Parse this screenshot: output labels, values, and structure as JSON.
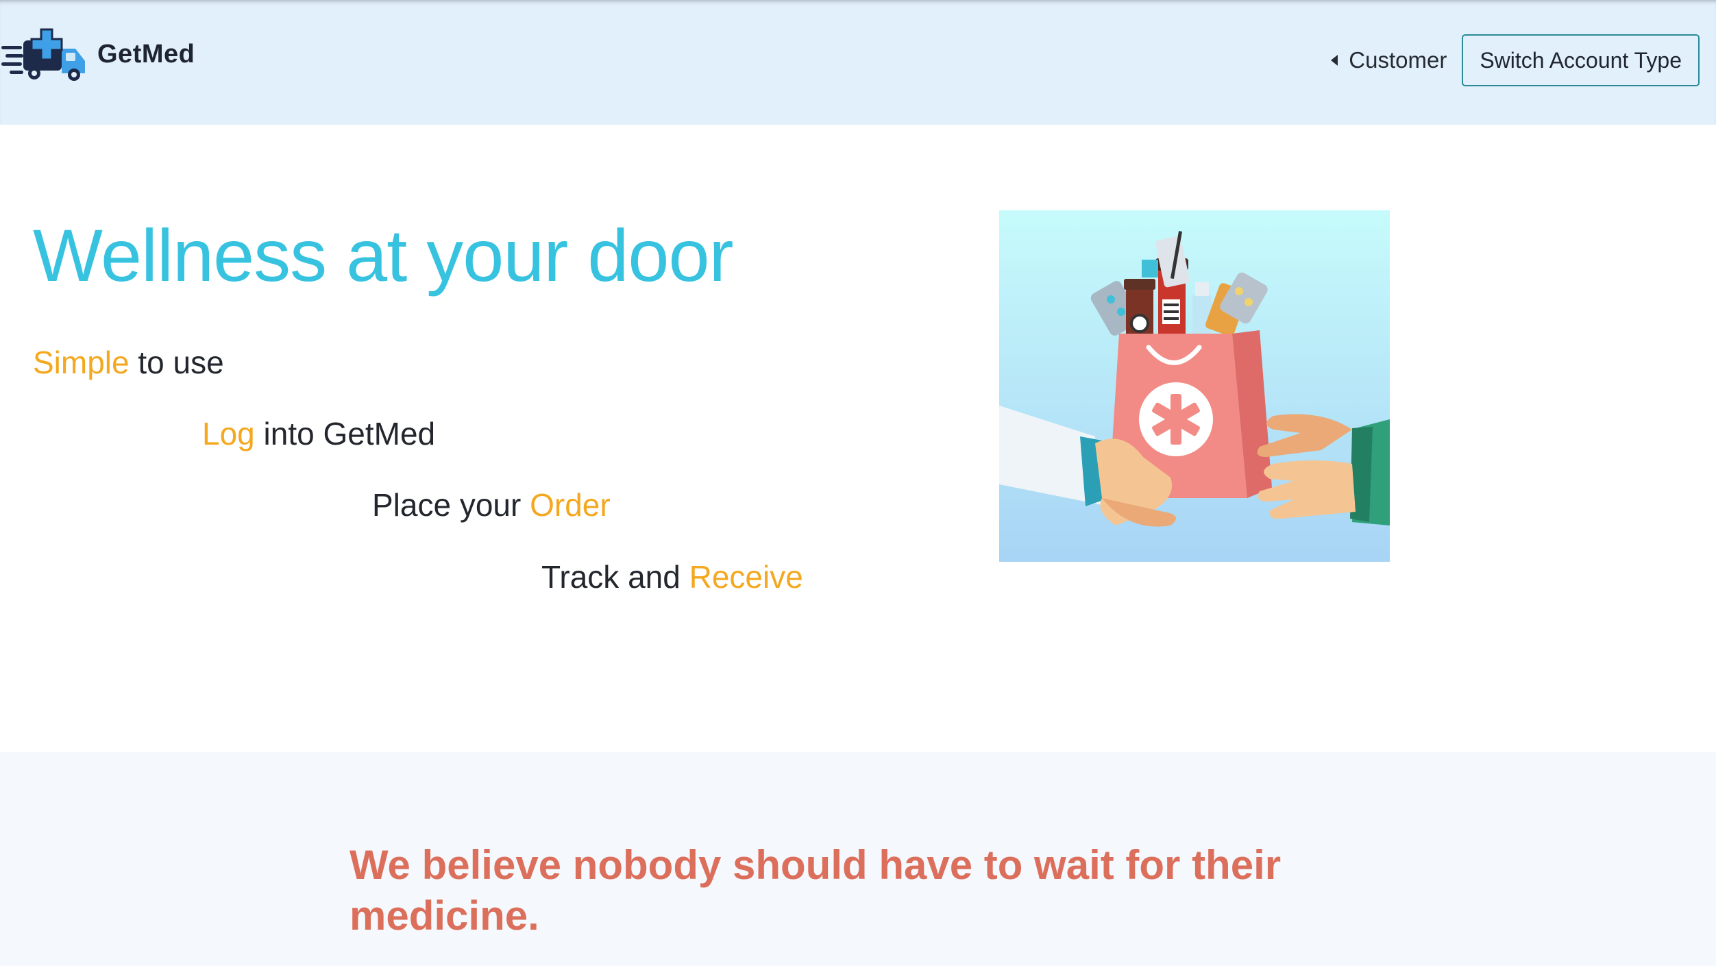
{
  "header": {
    "brand_name": "GetMed",
    "logo_icon": "delivery-truck-medical-cross-icon",
    "account_type_label": "Customer",
    "switch_button_label": "Switch Account Type"
  },
  "hero": {
    "title": "Wellness at your door",
    "steps": [
      {
        "highlight": "Simple",
        "text": " to use"
      },
      {
        "highlight": "Log",
        "text": " into GetMed"
      },
      {
        "prefix": "Place your ",
        "highlight": "Order"
      },
      {
        "prefix": "Track and ",
        "highlight": "Receive"
      }
    ],
    "illustration": "pharmacy-bag-handover-illustration"
  },
  "mission": {
    "statement": "We believe nobody should have to wait for their medicine."
  },
  "colors": {
    "header_bg": "#e2f0fb",
    "title": "#37c3e0",
    "highlight": "#f4a81f",
    "mission_text": "#dc6f5c",
    "mission_bg": "#f5f8fc",
    "button_border": "#2a8a99"
  }
}
